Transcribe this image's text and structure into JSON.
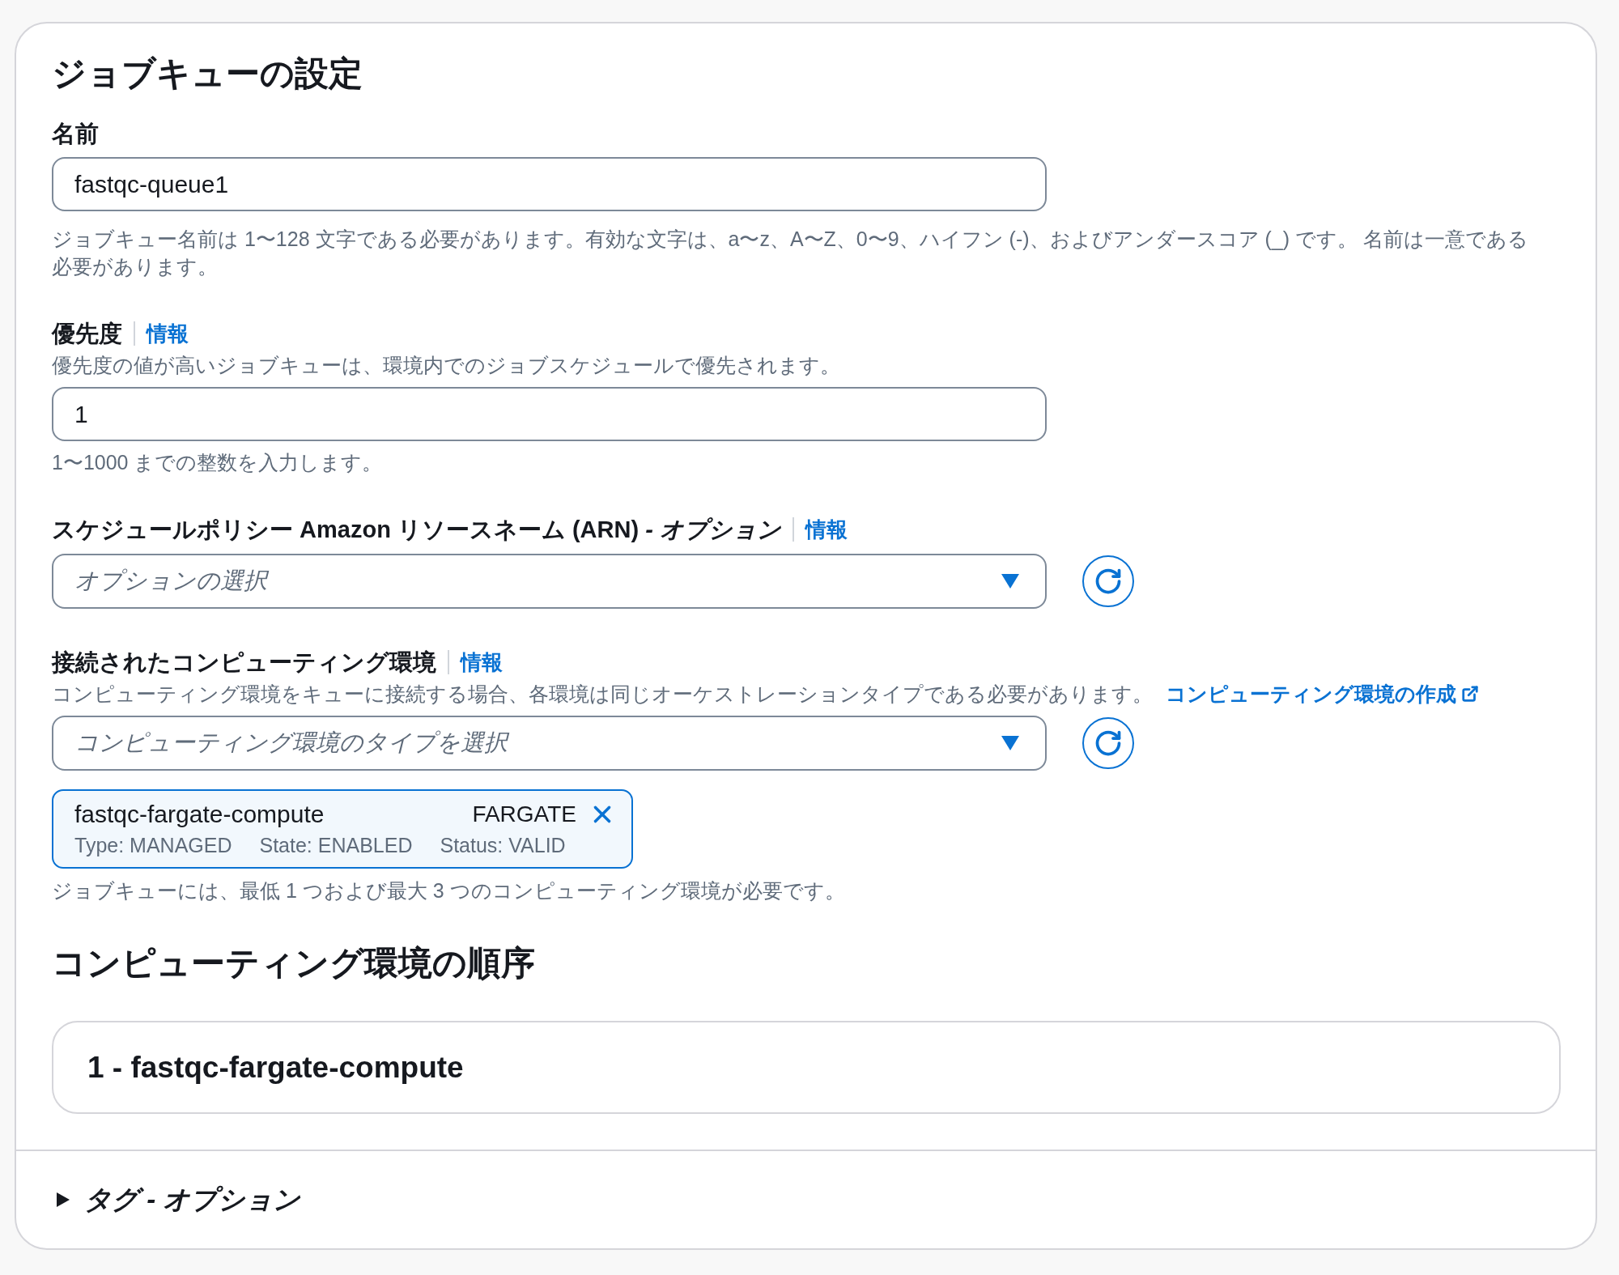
{
  "panel": {
    "title": "ジョブキューの設定"
  },
  "fields": [
    {
      "kind": "input",
      "label": "名前",
      "value": "fastqc-queue1",
      "constraint": "ジョブキュー名前は 1〜128 文字である必要があります。有効な文字は、a〜z、A〜Z、0〜9、ハイフン (-)、およびアンダースコア (_) です。 名前は一意である必要があります。"
    },
    {
      "kind": "input",
      "label": "優先度",
      "info": "情報",
      "description": "優先度の値が高いジョブキューは、環境内でのジョブスケジュールで優先されます。",
      "value": "1",
      "constraint": "1〜1000 までの整数を入力します。"
    },
    {
      "kind": "select",
      "label": "スケジュールポリシー Amazon リソースネーム (ARN) *- オプション*",
      "info": "情報",
      "placeholder": "オプションの選択"
    },
    {
      "kind": "select",
      "label": "接続されたコンピューティング環境",
      "info": "情報",
      "description": "コンピューティング環境をキューに接続する場合、各環境は同じオーケストレーションタイプである必要があります。",
      "link": "コンピューティング環境の作成",
      "placeholder": "コンピューティング環境のタイプを選択",
      "tokens": [
        {
          "name": "fastqc-fargate-compute",
          "type": "FARGATE",
          "details": [
            "Type: MANAGED",
            "State: ENABLED",
            "Status: VALID"
          ]
        }
      ],
      "constraint": "ジョブキューには、最低 1 つおよび最大 3 つのコンピューティング環境が必要です。"
    }
  ],
  "order": {
    "title": "コンピューティング環境の順序",
    "items": [
      "1 - fastqc-fargate-compute"
    ]
  },
  "tags_section": {
    "label": "タグ - オプション",
    "expanded": false
  }
}
